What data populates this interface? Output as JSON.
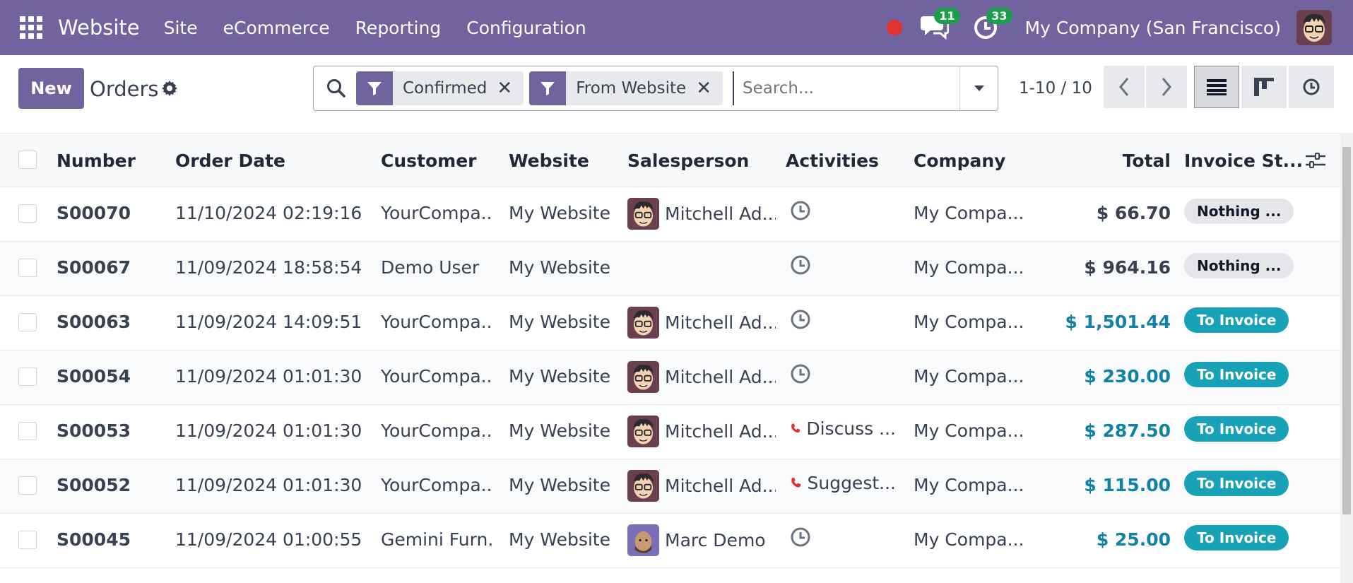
{
  "navbar": {
    "app_name": "Website",
    "menus": [
      "Site",
      "eCommerce",
      "Reporting",
      "Configuration"
    ],
    "messages_count": "11",
    "activities_count": "33",
    "company": "My Company (San Francisco)"
  },
  "control": {
    "new_label": "New",
    "title": "Orders",
    "facets": [
      "Confirmed",
      "From Website"
    ],
    "search_placeholder": "Search...",
    "pager": "1-10 / 10"
  },
  "table": {
    "headers": {
      "number": "Number",
      "order_date": "Order Date",
      "customer": "Customer",
      "website": "Website",
      "salesperson": "Salesperson",
      "activities": "Activities",
      "company": "Company",
      "total": "Total",
      "invoice_status": "Invoice St..."
    },
    "rows": [
      {
        "number": "S00070",
        "date": "11/10/2024 02:19:16",
        "customer": "YourCompa...",
        "website": "My Website",
        "salesperson": "Mitchell Ad...",
        "activity": "",
        "company": "My Compa...",
        "total": "$ 66.70",
        "status": "Nothing ..."
      },
      {
        "number": "S00067",
        "date": "11/09/2024 18:58:54",
        "customer": "Demo User",
        "website": "My Website",
        "salesperson": "",
        "activity": "",
        "company": "My Compa...",
        "total": "$ 964.16",
        "status": "Nothing ..."
      },
      {
        "number": "S00063",
        "date": "11/09/2024 14:09:51",
        "customer": "YourCompa...",
        "website": "My Website",
        "salesperson": "Mitchell Ad...",
        "activity": "",
        "company": "My Compa...",
        "total": "$ 1,501.44",
        "status": "To Invoice"
      },
      {
        "number": "S00054",
        "date": "11/09/2024 01:01:30",
        "customer": "YourCompa...",
        "website": "My Website",
        "salesperson": "Mitchell Ad...",
        "activity": "",
        "company": "My Compa...",
        "total": "$ 230.00",
        "status": "To Invoice"
      },
      {
        "number": "S00053",
        "date": "11/09/2024 01:01:30",
        "customer": "YourCompa...",
        "website": "My Website",
        "salesperson": "Mitchell Ad...",
        "activity": "Discuss ...",
        "company": "My Compa...",
        "total": "$ 287.50",
        "status": "To Invoice"
      },
      {
        "number": "S00052",
        "date": "11/09/2024 01:01:30",
        "customer": "YourCompa...",
        "website": "My Website",
        "salesperson": "Mitchell Ad...",
        "activity": "Suggest...",
        "company": "My Compa...",
        "total": "$ 115.00",
        "status": "To Invoice"
      },
      {
        "number": "S00045",
        "date": "11/09/2024 01:00:55",
        "customer": "Gemini Furn...",
        "website": "My Website",
        "salesperson": "Marc Demo",
        "activity": "",
        "company": "My Compa...",
        "total": "$ 25.00",
        "status": "To Invoice"
      }
    ]
  },
  "colors": {
    "brand": "#71639e",
    "badge_to_invoice": "#17a2b8",
    "badge_nothing": "#e4e6ea",
    "total_to_invoice": "#0f82a5",
    "phone_icon": "#e0322e",
    "notification_badge": "#1b9e4a"
  }
}
